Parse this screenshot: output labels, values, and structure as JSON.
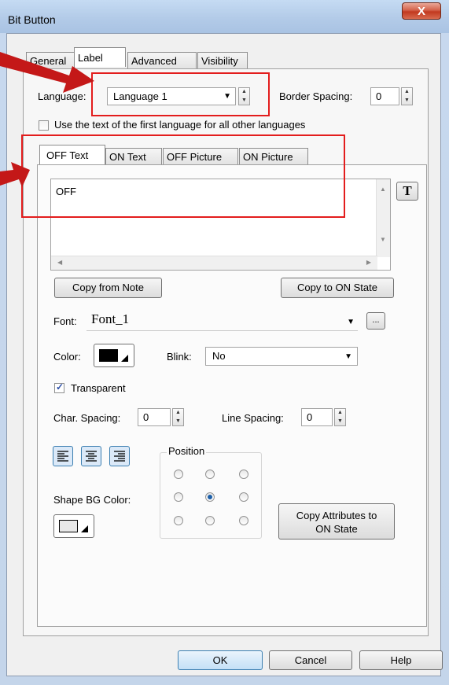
{
  "window": {
    "title": "Bit Button",
    "close_glyph": "X"
  },
  "tabs": [
    "General",
    "Label",
    "Advanced",
    "Visibility"
  ],
  "language": {
    "label": "Language:",
    "value": "Language 1"
  },
  "border_spacing": {
    "label": "Border Spacing:",
    "value": "0"
  },
  "use_first_language": {
    "label": "Use the text of the first language for all other languages",
    "checked": false
  },
  "subtabs": [
    "OFF Text",
    "ON Text",
    "OFF Picture",
    "ON Picture"
  ],
  "text_content": "OFF",
  "text_tool_glyph": "T",
  "copy_from_note": "Copy from Note",
  "copy_to_on": "Copy to ON State",
  "font": {
    "label": "Font:",
    "value": "Font_1",
    "browse": "..."
  },
  "color": {
    "label": "Color:",
    "swatch": "#000000"
  },
  "blink": {
    "label": "Blink:",
    "value": "No"
  },
  "transparent": {
    "label": "Transparent",
    "checked": true
  },
  "char_spacing": {
    "label": "Char. Spacing:",
    "value": "0"
  },
  "line_spacing": {
    "label": "Line Spacing:",
    "value": "0"
  },
  "position": {
    "label": "Position",
    "selected_row": 1,
    "selected_col": 1
  },
  "shape_bg": {
    "label": "Shape BG Color:"
  },
  "copy_attributes": {
    "line1": "Copy Attributes to",
    "line2": "ON State"
  },
  "buttons": {
    "ok": "OK",
    "cancel": "Cancel",
    "help": "Help"
  },
  "colors": {
    "annotation_red": "#e31d1d",
    "arrow_red": "#c41818"
  }
}
